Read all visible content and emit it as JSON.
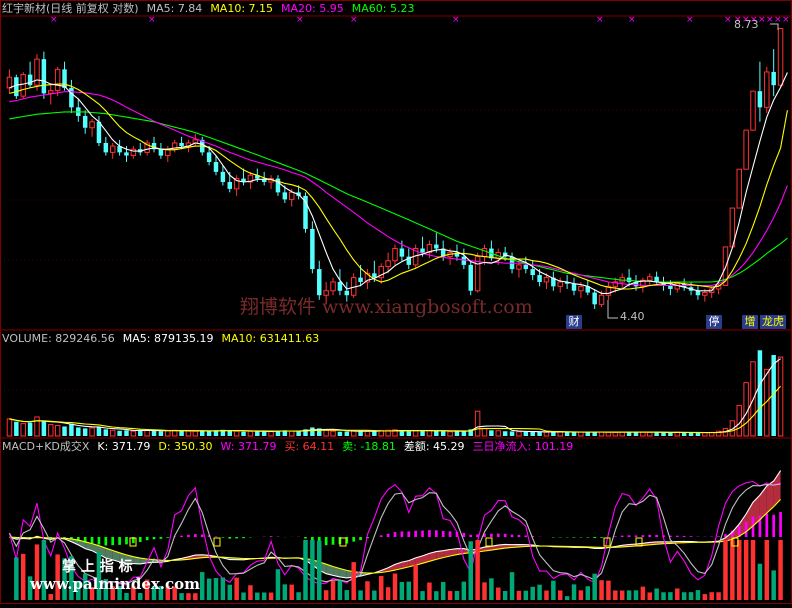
{
  "panels": {
    "price": {
      "title": "红宇新材(日线 前复权 对数)",
      "ma5_label": "MA5:",
      "ma5_value": "7.84",
      "ma10_label": "MA10:",
      "ma10_value": "7.15",
      "ma20_label": "MA20:",
      "ma20_value": "5.95",
      "ma60_label": "MA60:",
      "ma60_value": "5.23",
      "high_label": "8.73",
      "low_label": "4.40",
      "tag_cai": "财",
      "tag_ting": "停",
      "tag_zeng": "增",
      "tag_long": "龙虎",
      "watermark": "翔博软件 www.xiangbosoft.com"
    },
    "volume": {
      "volume_label": "VOLUME:",
      "volume_value": "829246.56",
      "ma5_label": "MA5:",
      "ma5_value": "879135.19",
      "ma10_label": "MA10:",
      "ma10_value": "631411.63"
    },
    "macd": {
      "title": "MACD+KD成交X",
      "k_label": "K",
      "k_value": ": 371.79",
      "d_label": "D",
      "d_value": ": 350.30",
      "w_label": "W",
      "w_value": ": 371.79",
      "buy_label": "买",
      "buy_value": ": 64.11",
      "sell_label": "卖",
      "sell_value": ": -18.81",
      "diff_label": "差额",
      "diff_value": ": 45.29",
      "flow_label": "三日净流入",
      "flow_value": ": 101.19",
      "watermark_cn": "掌 上 指 标",
      "watermark_url": "www.palmindex.com"
    }
  },
  "colors": {
    "up": "#ff3232",
    "down": "#54ffff",
    "ma5": "#ffffff",
    "ma10": "#ffff00",
    "ma20": "#ff00ff",
    "ma60": "#00ff00",
    "grid": "#800000",
    "text": "#c0c0c0",
    "vol_up": "#ff3232",
    "vol_down": "#54ffff"
  },
  "chart_data": [
    {
      "type": "candlestick",
      "title": "红宇新材(日线 前复权 对数)",
      "scale": "log",
      "ylim": [
        4.2,
        9.0
      ],
      "series_names": [
        "MA5",
        "MA10",
        "MA20",
        "MA60"
      ],
      "annotations": [
        {
          "text": "8.73",
          "type": "high"
        },
        {
          "text": "4.40",
          "type": "low"
        }
      ],
      "ohlc": [
        [
          7.55,
          7.9,
          7.45,
          7.75
        ],
        [
          7.75,
          7.8,
          7.35,
          7.4
        ],
        [
          7.4,
          7.85,
          7.35,
          7.8
        ],
        [
          7.8,
          8.05,
          7.55,
          7.6
        ],
        [
          7.6,
          8.2,
          7.5,
          8.1
        ],
        [
          8.1,
          8.25,
          7.35,
          7.45
        ],
        [
          7.45,
          7.6,
          7.25,
          7.5
        ],
        [
          7.5,
          7.95,
          7.4,
          7.9
        ],
        [
          7.9,
          8.05,
          7.5,
          7.55
        ],
        [
          7.55,
          7.7,
          7.1,
          7.2
        ],
        [
          7.2,
          7.35,
          6.95,
          7.05
        ],
        [
          7.05,
          7.15,
          6.75,
          6.85
        ],
        [
          6.85,
          7.0,
          6.7,
          6.95
        ],
        [
          6.95,
          7.05,
          6.55,
          6.6
        ],
        [
          6.6,
          6.7,
          6.4,
          6.45
        ],
        [
          6.45,
          6.6,
          6.35,
          6.55
        ],
        [
          6.55,
          6.65,
          6.4,
          6.45
        ],
        [
          6.45,
          6.55,
          6.3,
          6.4
        ],
        [
          6.4,
          6.55,
          6.35,
          6.5
        ],
        [
          6.5,
          6.6,
          6.4,
          6.45
        ],
        [
          6.45,
          6.65,
          6.4,
          6.6
        ],
        [
          6.6,
          6.7,
          6.45,
          6.5
        ],
        [
          6.5,
          6.6,
          6.35,
          6.4
        ],
        [
          6.4,
          6.55,
          6.3,
          6.5
        ],
        [
          6.5,
          6.65,
          6.45,
          6.6
        ],
        [
          6.6,
          6.7,
          6.5,
          6.55
        ],
        [
          6.55,
          6.65,
          6.45,
          6.6
        ],
        [
          6.6,
          6.75,
          6.55,
          6.65
        ],
        [
          6.65,
          6.7,
          6.4,
          6.45
        ],
        [
          6.45,
          6.55,
          6.25,
          6.3
        ],
        [
          6.3,
          6.4,
          6.1,
          6.15
        ],
        [
          6.15,
          6.25,
          5.95,
          6.0
        ],
        [
          6.0,
          6.15,
          5.85,
          5.9
        ],
        [
          5.9,
          6.1,
          5.8,
          6.05
        ],
        [
          6.05,
          6.2,
          5.95,
          6.0
        ],
        [
          6.0,
          6.15,
          5.9,
          6.1
        ],
        [
          6.1,
          6.2,
          6.0,
          6.05
        ],
        [
          6.05,
          6.15,
          5.95,
          6.0
        ],
        [
          6.0,
          6.1,
          5.9,
          6.05
        ],
        [
          6.05,
          6.1,
          5.8,
          5.85
        ],
        [
          5.85,
          5.95,
          5.7,
          5.75
        ],
        [
          5.75,
          5.9,
          5.65,
          5.85
        ],
        [
          5.85,
          5.95,
          5.75,
          5.8
        ],
        [
          5.8,
          5.85,
          5.3,
          5.35
        ],
        [
          5.35,
          5.45,
          4.8,
          4.85
        ],
        [
          4.85,
          4.95,
          4.5,
          4.55
        ],
        [
          4.55,
          4.7,
          4.45,
          4.6
        ],
        [
          4.6,
          4.75,
          4.55,
          4.7
        ],
        [
          4.7,
          4.85,
          4.55,
          4.6
        ],
        [
          4.6,
          4.7,
          4.48,
          4.55
        ],
        [
          4.55,
          4.8,
          4.52,
          4.75
        ],
        [
          4.75,
          4.9,
          4.65,
          4.7
        ],
        [
          4.7,
          4.85,
          4.62,
          4.8
        ],
        [
          4.8,
          4.95,
          4.7,
          4.75
        ],
        [
          4.75,
          4.92,
          4.68,
          4.88
        ],
        [
          4.88,
          5.05,
          4.8,
          4.95
        ],
        [
          4.95,
          5.15,
          4.9,
          5.1
        ],
        [
          5.1,
          5.2,
          4.95,
          5.0
        ],
        [
          5.0,
          5.1,
          4.85,
          4.9
        ],
        [
          4.9,
          5.15,
          4.85,
          5.1
        ],
        [
          5.1,
          5.25,
          5.0,
          5.05
        ],
        [
          5.05,
          5.2,
          4.98,
          5.15
        ],
        [
          5.15,
          5.3,
          5.05,
          5.1
        ],
        [
          5.1,
          5.2,
          4.95,
          5.0
        ],
        [
          5.0,
          5.1,
          4.9,
          5.05
        ],
        [
          5.05,
          5.15,
          4.95,
          5.0
        ],
        [
          5.0,
          5.1,
          4.85,
          4.9
        ],
        [
          4.9,
          4.95,
          4.55,
          4.6
        ],
        [
          4.6,
          5.05,
          4.58,
          5.0
        ],
        [
          5.0,
          5.15,
          4.9,
          5.1
        ],
        [
          5.1,
          5.2,
          4.95,
          4.98
        ],
        [
          4.98,
          5.1,
          4.9,
          5.05
        ],
        [
          5.05,
          5.12,
          4.95,
          5.0
        ],
        [
          5.0,
          5.05,
          4.8,
          4.85
        ],
        [
          4.85,
          4.95,
          4.75,
          4.9
        ],
        [
          4.9,
          5.0,
          4.8,
          4.85
        ],
        [
          4.85,
          4.95,
          4.72,
          4.78
        ],
        [
          4.78,
          4.85,
          4.65,
          4.7
        ],
        [
          4.7,
          4.8,
          4.62,
          4.75
        ],
        [
          4.75,
          4.82,
          4.6,
          4.65
        ],
        [
          4.65,
          4.75,
          4.58,
          4.7
        ],
        [
          4.7,
          4.78,
          4.62,
          4.68
        ],
        [
          4.68,
          4.75,
          4.55,
          4.6
        ],
        [
          4.6,
          4.7,
          4.52,
          4.65
        ],
        [
          4.65,
          4.72,
          4.55,
          4.58
        ],
        [
          4.58,
          4.62,
          4.4,
          4.45
        ],
        [
          4.45,
          4.6,
          4.42,
          4.55
        ],
        [
          4.55,
          4.7,
          4.5,
          4.65
        ],
        [
          4.65,
          4.75,
          4.58,
          4.7
        ],
        [
          4.7,
          4.8,
          4.62,
          4.75
        ],
        [
          4.75,
          4.85,
          4.65,
          4.7
        ],
        [
          4.7,
          4.78,
          4.6,
          4.65
        ],
        [
          4.65,
          4.75,
          4.58,
          4.72
        ],
        [
          4.72,
          4.8,
          4.65,
          4.76
        ],
        [
          4.76,
          4.82,
          4.68,
          4.7
        ],
        [
          4.7,
          4.76,
          4.6,
          4.66
        ],
        [
          4.66,
          4.72,
          4.55,
          4.62
        ],
        [
          4.62,
          4.7,
          4.58,
          4.68
        ],
        [
          4.68,
          4.74,
          4.6,
          4.64
        ],
        [
          4.64,
          4.7,
          4.55,
          4.6
        ],
        [
          4.6,
          4.66,
          4.5,
          4.55
        ],
        [
          4.55,
          4.62,
          4.48,
          4.58
        ],
        [
          4.58,
          4.65,
          4.52,
          4.62
        ],
        [
          4.62,
          4.7,
          4.56,
          4.66
        ],
        [
          4.66,
          5.12,
          4.66,
          5.12
        ],
        [
          5.12,
          5.63,
          5.12,
          5.63
        ],
        [
          5.63,
          6.19,
          5.63,
          6.19
        ],
        [
          6.19,
          6.81,
          6.19,
          6.81
        ],
        [
          6.81,
          7.49,
          6.81,
          7.49
        ],
        [
          7.49,
          8.05,
          6.95,
          7.2
        ],
        [
          7.2,
          7.95,
          7.1,
          7.85
        ],
        [
          7.85,
          8.3,
          7.4,
          7.6
        ],
        [
          7.6,
          8.73,
          7.55,
          8.73
        ]
      ],
      "ma5": [
        7.55,
        7.6,
        7.62,
        7.65,
        7.7,
        7.68,
        7.62,
        7.6,
        7.58,
        7.45,
        7.35,
        7.2,
        7.05,
        6.95,
        6.8,
        6.65,
        6.55,
        6.5,
        6.47,
        6.47,
        6.5,
        6.52,
        6.5,
        6.5,
        6.52,
        6.53,
        6.55,
        6.6,
        6.58,
        6.52,
        6.4,
        6.25,
        6.1,
        6.02,
        6.0,
        6.01,
        6.04,
        6.04,
        6.04,
        6.0,
        5.92,
        5.86,
        5.82,
        5.72,
        5.52,
        5.28,
        5.05,
        4.85,
        4.72,
        4.62,
        4.64,
        4.66,
        4.72,
        4.74,
        4.78,
        4.82,
        4.89,
        4.94,
        4.98,
        5.01,
        5.03,
        5.06,
        5.08,
        5.09,
        5.07,
        5.06,
        5.02,
        4.94,
        4.91,
        4.93,
        4.92,
        4.95,
        5.02,
        5.0,
        4.96,
        4.93,
        4.88,
        4.82,
        4.78,
        4.74,
        4.71,
        4.7,
        4.68,
        4.67,
        4.65,
        4.61,
        4.57,
        4.57,
        4.6,
        4.62,
        4.67,
        4.7,
        4.71,
        4.71,
        4.7,
        4.69,
        4.68,
        4.66,
        4.64,
        4.62,
        4.6,
        4.6,
        4.6,
        4.7,
        4.87,
        5.11,
        5.44,
        5.85,
        6.23,
        6.63,
        7.03,
        7.33,
        7.56,
        7.84
      ],
      "ma10": [
        7.45,
        7.48,
        7.52,
        7.55,
        7.58,
        7.6,
        7.61,
        7.62,
        7.62,
        7.58,
        7.52,
        7.44,
        7.35,
        7.26,
        7.14,
        7.0,
        6.87,
        6.77,
        6.7,
        6.64,
        6.57,
        6.53,
        6.5,
        6.49,
        6.49,
        6.51,
        6.53,
        6.55,
        6.55,
        6.53,
        6.48,
        6.4,
        6.32,
        6.25,
        6.18,
        6.13,
        6.1,
        6.06,
        6.03,
        6.01,
        5.98,
        5.96,
        5.93,
        5.88,
        5.77,
        5.64,
        5.49,
        5.35,
        5.22,
        5.08,
        4.96,
        4.86,
        4.79,
        4.73,
        4.7,
        4.72,
        4.76,
        4.8,
        4.83,
        4.86,
        4.9,
        4.94,
        4.98,
        5.01,
        5.03,
        5.04,
        5.04,
        5.03,
        5.01,
        5.0,
        4.99,
        4.98,
        4.97,
        4.97,
        4.97,
        4.97,
        4.95,
        4.94,
        4.92,
        4.89,
        4.86,
        4.82,
        4.78,
        4.75,
        4.72,
        4.69,
        4.66,
        4.64,
        4.63,
        4.62,
        4.62,
        4.63,
        4.64,
        4.66,
        4.67,
        4.68,
        4.69,
        4.69,
        4.68,
        4.67,
        4.66,
        4.65,
        4.64,
        4.65,
        4.71,
        4.83,
        4.98,
        5.16,
        5.39,
        5.65,
        5.96,
        6.25,
        6.52,
        7.15
      ],
      "ma20": [
        7.3,
        7.32,
        7.35,
        7.38,
        7.4,
        7.42,
        7.44,
        7.46,
        7.48,
        7.48,
        7.47,
        7.46,
        7.44,
        7.42,
        7.38,
        7.33,
        7.27,
        7.2,
        7.14,
        7.08,
        7.02,
        6.96,
        6.91,
        6.86,
        6.81,
        6.76,
        6.71,
        6.67,
        6.63,
        6.59,
        6.55,
        6.5,
        6.45,
        6.41,
        6.37,
        6.33,
        6.3,
        6.27,
        6.24,
        6.21,
        6.18,
        6.14,
        6.11,
        6.07,
        6.0,
        5.93,
        5.85,
        5.78,
        5.71,
        5.64,
        5.57,
        5.5,
        5.43,
        5.37,
        5.31,
        5.25,
        5.2,
        5.15,
        5.11,
        5.07,
        5.04,
        5.02,
        5.0,
        4.99,
        4.98,
        4.97,
        4.96,
        4.95,
        4.94,
        4.93,
        4.93,
        4.93,
        4.92,
        4.92,
        4.92,
        4.91,
        4.9,
        4.89,
        4.88,
        4.86,
        4.84,
        4.82,
        4.8,
        4.78,
        4.76,
        4.74,
        4.72,
        4.7,
        4.69,
        4.68,
        4.67,
        4.67,
        4.66,
        4.66,
        4.66,
        4.66,
        4.66,
        4.66,
        4.66,
        4.66,
        4.66,
        4.66,
        4.66,
        4.68,
        4.72,
        4.78,
        4.85,
        4.94,
        5.05,
        5.18,
        5.33,
        5.5,
        5.7,
        5.95
      ],
      "ma60": [
        7.0,
        7.02,
        7.04,
        7.06,
        7.08,
        7.09,
        7.1,
        7.11,
        7.12,
        7.12,
        7.12,
        7.12,
        7.11,
        7.1,
        7.09,
        7.07,
        7.05,
        7.03,
        7.01,
        6.99,
        6.97,
        6.95,
        6.92,
        6.89,
        6.86,
        6.83,
        6.8,
        6.77,
        6.73,
        6.69,
        6.65,
        6.61,
        6.57,
        6.53,
        6.49,
        6.45,
        6.41,
        6.37,
        6.33,
        6.29,
        6.25,
        6.21,
        6.17,
        6.13,
        6.08,
        6.03,
        5.98,
        5.93,
        5.88,
        5.83,
        5.79,
        5.75,
        5.71,
        5.67,
        5.63,
        5.59,
        5.55,
        5.51,
        5.47,
        5.43,
        5.39,
        5.35,
        5.31,
        5.27,
        5.23,
        5.19,
        5.16,
        5.13,
        5.1,
        5.07,
        5.04,
        5.01,
        4.98,
        4.96,
        4.94,
        4.92,
        4.9,
        4.88,
        4.86,
        4.84,
        4.82,
        4.8,
        4.79,
        4.78,
        4.77,
        4.76,
        4.75,
        4.74,
        4.73,
        4.72,
        4.72,
        4.71,
        4.71,
        4.71,
        4.7,
        4.7,
        4.7,
        4.7,
        4.7,
        4.7,
        4.7,
        4.7,
        4.7,
        4.71,
        4.73,
        4.76,
        4.8,
        4.85,
        4.91,
        4.97,
        5.04,
        5.1,
        5.16,
        5.23
      ]
    },
    {
      "type": "bar",
      "title": "VOLUME",
      "series_names": [
        "VOLUME",
        "MA5",
        "MA10"
      ],
      "values": [
        180000,
        150000,
        130000,
        140000,
        200000,
        160000,
        120000,
        110000,
        100000,
        130000,
        90000,
        80000,
        85000,
        95000,
        70000,
        60000,
        55000,
        60000,
        50000,
        65000,
        60000,
        55000,
        50000,
        55000,
        60000,
        58000,
        52000,
        50000,
        48000,
        55000,
        60000,
        65000,
        58000,
        50000,
        45000,
        48000,
        52000,
        50000,
        46000,
        55000,
        60000,
        52000,
        48000,
        70000,
        90000,
        80000,
        60000,
        50000,
        45000,
        48000,
        55000,
        52000,
        50000,
        48000,
        55000,
        60000,
        65000,
        58000,
        50000,
        55000,
        60000,
        58000,
        52000,
        48000,
        45000,
        50000,
        55000,
        70000,
        260000,
        80000,
        60000,
        55000,
        50000,
        48000,
        45000,
        42000,
        44000,
        46000,
        40000,
        45000,
        42000,
        40000,
        38000,
        42000,
        40000,
        45000,
        42000,
        40000,
        38000,
        40000,
        42000,
        44000,
        40000,
        38000,
        36000,
        35000,
        38000,
        40000,
        36000,
        34000,
        33000,
        35000,
        38000,
        50000,
        80000,
        160000,
        320000,
        560000,
        780000,
        900000,
        700000,
        850000,
        829246.56
      ]
    },
    {
      "type": "bar",
      "title": "MACD+KD成交X",
      "series_names": [
        "K",
        "D",
        "W",
        "买",
        "卖",
        "差额",
        "三日净流入"
      ],
      "note_values": {
        "K": 371.79,
        "D": 350.3,
        "W": 371.79,
        "买": 64.11,
        "卖": -18.81,
        "差额": 45.29,
        "三日净流入": 101.19
      }
    }
  ]
}
